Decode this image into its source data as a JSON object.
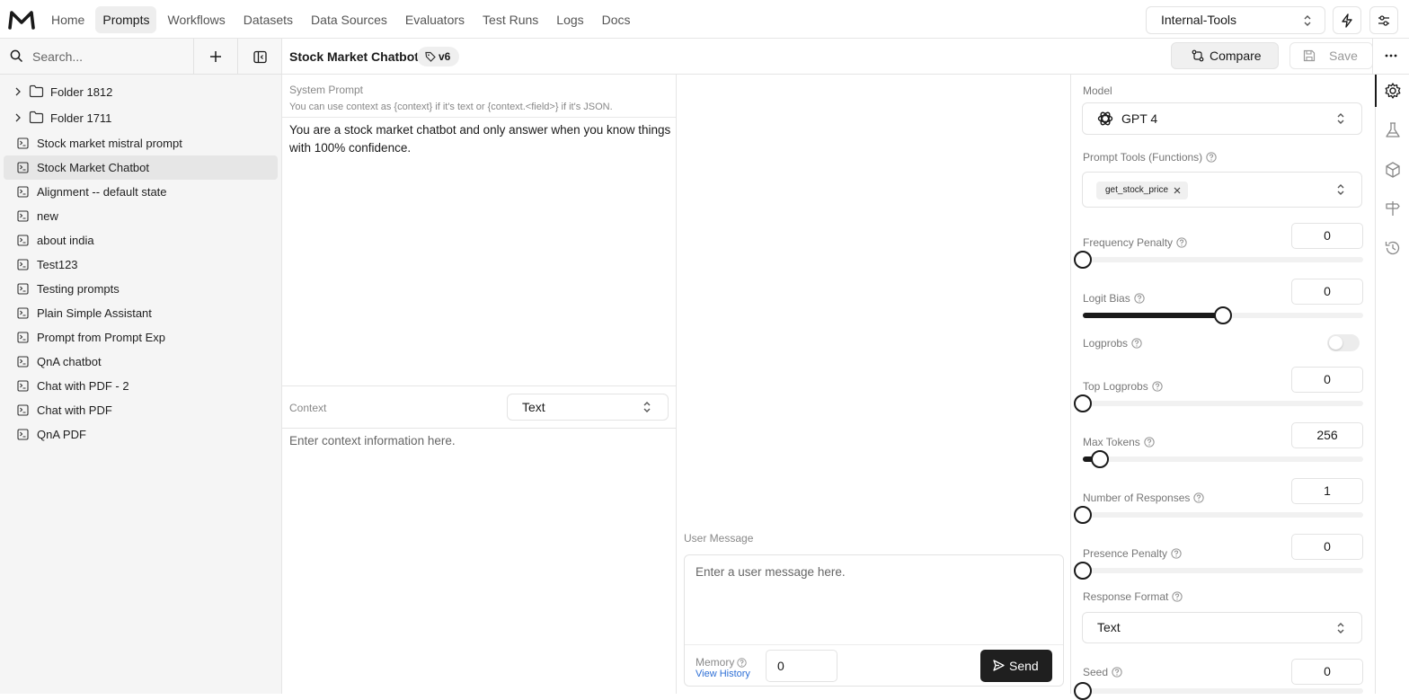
{
  "nav": {
    "items": [
      "Home",
      "Prompts",
      "Workflows",
      "Datasets",
      "Data Sources",
      "Evaluators",
      "Test Runs",
      "Logs",
      "Docs"
    ],
    "active": "Prompts"
  },
  "workspace": "Internal-Tools",
  "sidebar": {
    "search_placeholder": "Search...",
    "folders": [
      "Folder 1812",
      "Folder 1711"
    ],
    "prompts": [
      "Stock market mistral prompt",
      "Stock Market Chatbot",
      "Alignment -- default state",
      "new",
      "about india",
      "Test123",
      "Testing prompts",
      "Plain Simple Assistant",
      "Prompt from Prompt Exp",
      "QnA chatbot",
      "Chat with PDF - 2",
      "Chat with PDF",
      "QnA PDF"
    ],
    "selected": "Stock Market Chatbot"
  },
  "header": {
    "title": "Stock Market Chatbot",
    "version": "v6",
    "compare_label": "Compare",
    "save_label": "Save"
  },
  "system_prompt": {
    "label": "System Prompt",
    "hint": "You can use context as {context} if it's text or {context.<field>} if it's JSON.",
    "text": "You are a stock market chatbot and only answer when you know things with 100% confidence."
  },
  "context": {
    "label": "Context",
    "type": "Text",
    "placeholder": "Enter context information here."
  },
  "user_message": {
    "label": "User Message",
    "placeholder": "Enter a user message here.",
    "memory_label": "Memory",
    "view_history": "View History",
    "memory_value": "0",
    "send_label": "Send"
  },
  "params": {
    "model_label": "Model",
    "model": "GPT 4",
    "tools_label": "Prompt Tools (Functions)",
    "tool_chip": "get_stock_price",
    "frequency_penalty": {
      "label": "Frequency Penalty",
      "value": "0",
      "fraction": 0.0
    },
    "logit_bias": {
      "label": "Logit Bias",
      "value": "0",
      "fraction": 0.5
    },
    "logprobs": {
      "label": "Logprobs",
      "on": false
    },
    "top_logprobs": {
      "label": "Top Logprobs",
      "value": "0",
      "fraction": 0.0
    },
    "max_tokens": {
      "label": "Max Tokens",
      "value": "256",
      "fraction": 0.06
    },
    "num_responses": {
      "label": "Number of Responses",
      "value": "1",
      "fraction": 0.0
    },
    "presence_penalty": {
      "label": "Presence Penalty",
      "value": "0",
      "fraction": 0.0
    },
    "response_format_label": "Response Format",
    "response_format": "Text",
    "seed": {
      "label": "Seed",
      "value": "0"
    }
  },
  "rail_icons": [
    "settings-icon",
    "flask-icon",
    "cube-icon",
    "signpost-icon",
    "history-icon"
  ]
}
